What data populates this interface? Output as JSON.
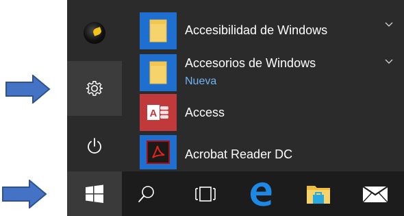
{
  "rail": {
    "avatar_icon": "user-avatar",
    "settings_icon": "gear-icon",
    "power_icon": "power-icon"
  },
  "apps": [
    {
      "label": "Accesibilidad de Windows",
      "icon": "folder-icon",
      "badge": "",
      "expandable": true
    },
    {
      "label": "Accesorios de Windows",
      "icon": "folder-icon",
      "badge": "Nueva",
      "expandable": true
    },
    {
      "label": "Access",
      "icon": "access-icon",
      "badge": "",
      "expandable": false
    },
    {
      "label": "Acrobat Reader DC",
      "icon": "acrobat-icon",
      "badge": "",
      "expandable": false
    }
  ],
  "taskbar": {
    "items": [
      "windows-logo-icon",
      "search-icon",
      "task-view-icon",
      "edge-icon",
      "file-explorer-icon",
      "mail-icon"
    ]
  },
  "colors": {
    "menu_bg": "#2b2b2b",
    "taskbar_bg": "#1c1c1c",
    "highlight": "#3c3c3c",
    "tile_blue": "#1e6fd0",
    "access_red": "#c0393b",
    "badge_blue": "#6fb3f2",
    "arrow_blue": "#4472c4"
  }
}
